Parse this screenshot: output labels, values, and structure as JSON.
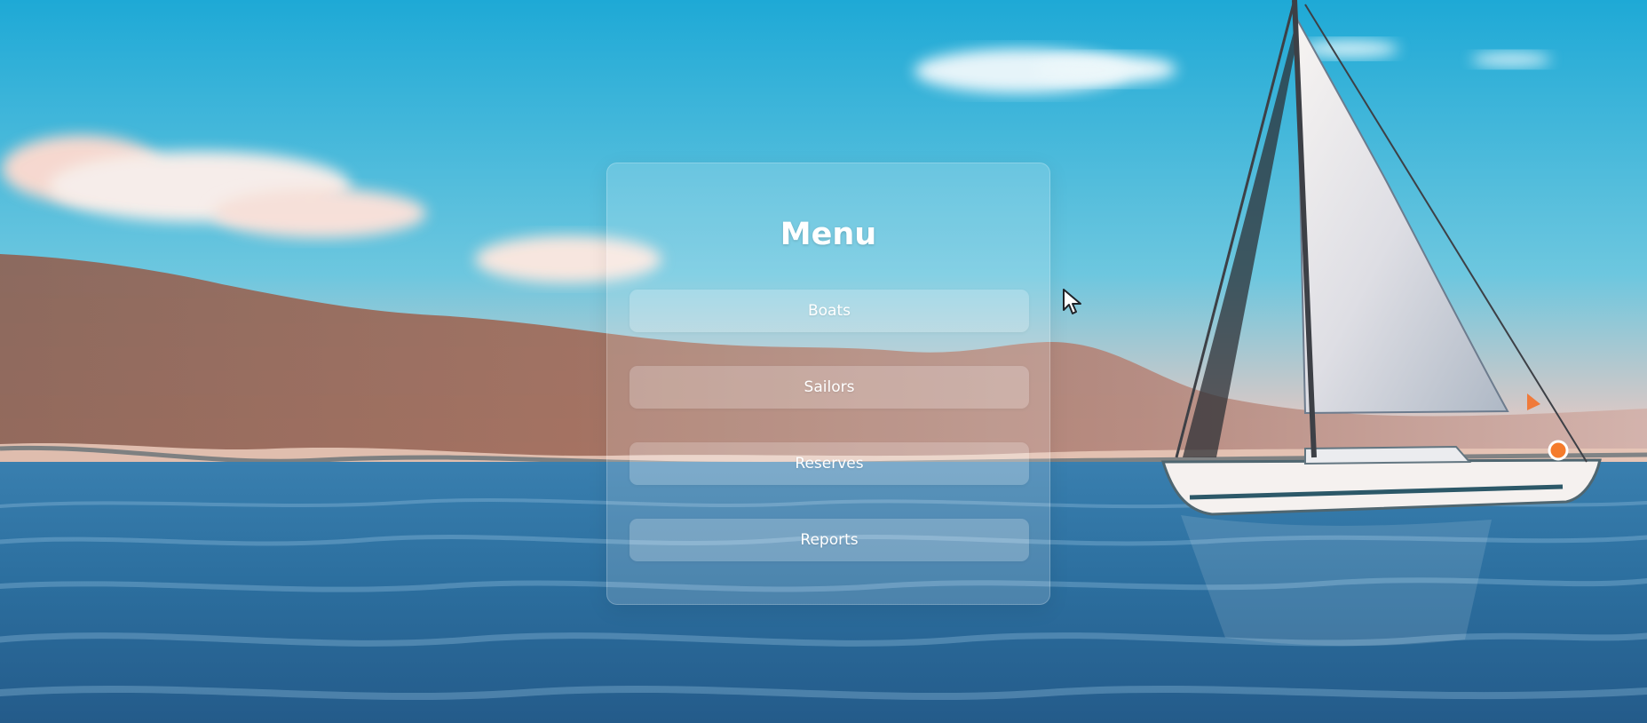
{
  "menu": {
    "title": "Menu",
    "items": [
      {
        "label": "Boats"
      },
      {
        "label": "Sailors"
      },
      {
        "label": "Reserves"
      },
      {
        "label": "Reports"
      }
    ]
  },
  "background": {
    "icon": "sailboat-sea-scene",
    "colors": {
      "sky_top": "#1ea9d6",
      "sky_horizon": "#f7d2c8",
      "sea": "#2d6f9f",
      "glass": "#ffffff"
    }
  },
  "cursor": {
    "icon": "mouse-pointer-icon"
  }
}
